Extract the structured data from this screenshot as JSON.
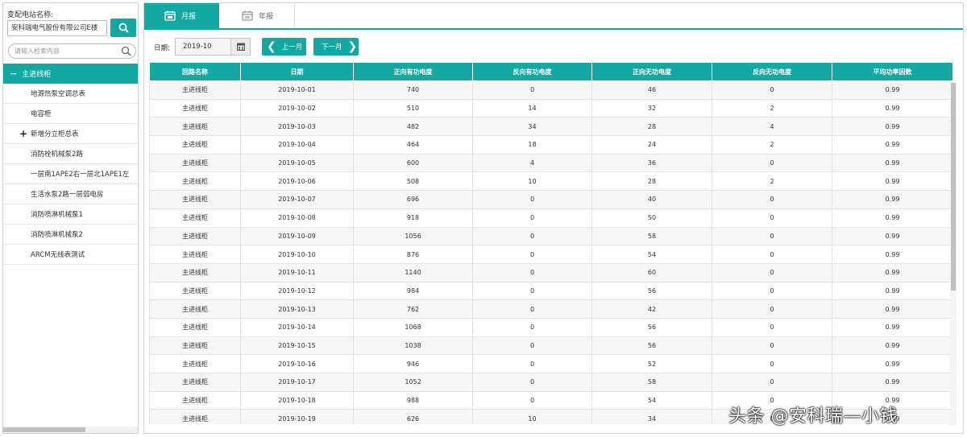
{
  "sidebar": {
    "station_label": "变配电站名称:",
    "station_value": "安科瑞电气股份有限公司E楼",
    "search_placeholder": "请输入检索内容",
    "root_item": "主进线柜",
    "items": [
      {
        "label": "地源热泵空调总表",
        "expandable": false
      },
      {
        "label": "电容柜",
        "expandable": false
      },
      {
        "label": "新增分立柜总表",
        "expandable": true
      },
      {
        "label": "消防栓机械泵2路",
        "expandable": false
      },
      {
        "label": "一层南1APE2右一层北1APE1左",
        "expandable": false
      },
      {
        "label": "生活水泵2路一层弱电房",
        "expandable": false
      },
      {
        "label": "消防喷淋机械泵1",
        "expandable": false
      },
      {
        "label": "消防喷淋机械泵2",
        "expandable": false
      },
      {
        "label": "ARCM无线表测试",
        "expandable": false
      }
    ]
  },
  "tabs": {
    "month": "月报",
    "year": "年报",
    "active": "month"
  },
  "filter": {
    "date_label": "日期:",
    "date_value": "2019-10",
    "prev_label": "上一月",
    "next_label": "下一月"
  },
  "table": {
    "headers": [
      "回路名称",
      "日期",
      "正向有功电度",
      "反向有功电度",
      "正向无功电度",
      "反向无功电度",
      "平均功率因数"
    ],
    "rows": [
      [
        "主进线柜",
        "2019-10-01",
        "740",
        "0",
        "46",
        "0",
        "0.99"
      ],
      [
        "主进线柜",
        "2019-10-02",
        "510",
        "14",
        "32",
        "2",
        "0.99"
      ],
      [
        "主进线柜",
        "2019-10-03",
        "482",
        "34",
        "28",
        "4",
        "0.99"
      ],
      [
        "主进线柜",
        "2019-10-04",
        "464",
        "18",
        "24",
        "2",
        "0.99"
      ],
      [
        "主进线柜",
        "2019-10-05",
        "600",
        "4",
        "36",
        "0",
        "0.99"
      ],
      [
        "主进线柜",
        "2019-10-06",
        "508",
        "10",
        "28",
        "2",
        "0.99"
      ],
      [
        "主进线柜",
        "2019-10-07",
        "696",
        "0",
        "40",
        "0",
        "0.99"
      ],
      [
        "主进线柜",
        "2019-10-08",
        "918",
        "0",
        "50",
        "0",
        "0.99"
      ],
      [
        "主进线柜",
        "2019-10-09",
        "1056",
        "0",
        "58",
        "0",
        "0.99"
      ],
      [
        "主进线柜",
        "2019-10-10",
        "876",
        "0",
        "54",
        "0",
        "0.99"
      ],
      [
        "主进线柜",
        "2019-10-11",
        "1140",
        "0",
        "60",
        "0",
        "0.99"
      ],
      [
        "主进线柜",
        "2019-10-12",
        "984",
        "0",
        "56",
        "0",
        "0.99"
      ],
      [
        "主进线柜",
        "2019-10-13",
        "762",
        "0",
        "42",
        "0",
        "0.99"
      ],
      [
        "主进线柜",
        "2019-10-14",
        "1068",
        "0",
        "56",
        "0",
        "0.99"
      ],
      [
        "主进线柜",
        "2019-10-15",
        "1038",
        "0",
        "56",
        "0",
        "0.99"
      ],
      [
        "主进线柜",
        "2019-10-16",
        "946",
        "0",
        "52",
        "0",
        "0.99"
      ],
      [
        "主进线柜",
        "2019-10-17",
        "1052",
        "0",
        "58",
        "0",
        "0.99"
      ],
      [
        "主进线柜",
        "2019-10-18",
        "988",
        "0",
        "54",
        "0",
        "0.99"
      ],
      [
        "主进线柜",
        "2019-10-19",
        "626",
        "10",
        "34",
        "0",
        "0.99"
      ]
    ]
  },
  "watermark": "头条 @安科瑞—小钱",
  "colors": {
    "accent": "#13a8a1",
    "row_alt": "#f6f6f6"
  },
  "icons": {
    "search_button": "search-icon",
    "tree_search": "magnifier-icon",
    "tab_month": "calendar-month-icon",
    "tab_year": "calendar-year-icon",
    "date_picker": "calendar-icon",
    "prev": "chevron-left-icon",
    "next": "chevron-right-icon"
  }
}
